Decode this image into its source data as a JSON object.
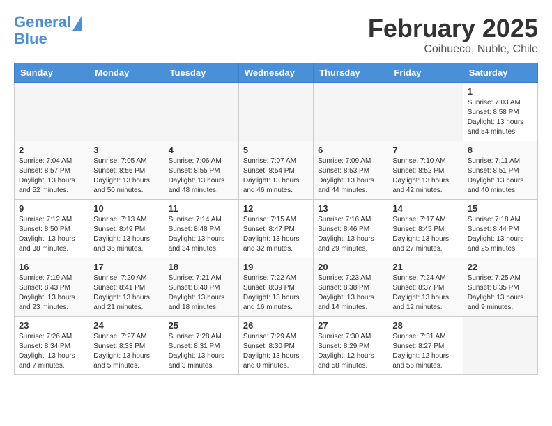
{
  "header": {
    "logo_line1": "General",
    "logo_line2": "Blue",
    "month": "February 2025",
    "location": "Coihueco, Nuble, Chile"
  },
  "days_of_week": [
    "Sunday",
    "Monday",
    "Tuesday",
    "Wednesday",
    "Thursday",
    "Friday",
    "Saturday"
  ],
  "weeks": [
    [
      {
        "num": "",
        "info": ""
      },
      {
        "num": "",
        "info": ""
      },
      {
        "num": "",
        "info": ""
      },
      {
        "num": "",
        "info": ""
      },
      {
        "num": "",
        "info": ""
      },
      {
        "num": "",
        "info": ""
      },
      {
        "num": "1",
        "info": "Sunrise: 7:03 AM\nSunset: 8:58 PM\nDaylight: 13 hours and 54 minutes."
      }
    ],
    [
      {
        "num": "2",
        "info": "Sunrise: 7:04 AM\nSunset: 8:57 PM\nDaylight: 13 hours and 52 minutes."
      },
      {
        "num": "3",
        "info": "Sunrise: 7:05 AM\nSunset: 8:56 PM\nDaylight: 13 hours and 50 minutes."
      },
      {
        "num": "4",
        "info": "Sunrise: 7:06 AM\nSunset: 8:55 PM\nDaylight: 13 hours and 48 minutes."
      },
      {
        "num": "5",
        "info": "Sunrise: 7:07 AM\nSunset: 8:54 PM\nDaylight: 13 hours and 46 minutes."
      },
      {
        "num": "6",
        "info": "Sunrise: 7:09 AM\nSunset: 8:53 PM\nDaylight: 13 hours and 44 minutes."
      },
      {
        "num": "7",
        "info": "Sunrise: 7:10 AM\nSunset: 8:52 PM\nDaylight: 13 hours and 42 minutes."
      },
      {
        "num": "8",
        "info": "Sunrise: 7:11 AM\nSunset: 8:51 PM\nDaylight: 13 hours and 40 minutes."
      }
    ],
    [
      {
        "num": "9",
        "info": "Sunrise: 7:12 AM\nSunset: 8:50 PM\nDaylight: 13 hours and 38 minutes."
      },
      {
        "num": "10",
        "info": "Sunrise: 7:13 AM\nSunset: 8:49 PM\nDaylight: 13 hours and 36 minutes."
      },
      {
        "num": "11",
        "info": "Sunrise: 7:14 AM\nSunset: 8:48 PM\nDaylight: 13 hours and 34 minutes."
      },
      {
        "num": "12",
        "info": "Sunrise: 7:15 AM\nSunset: 8:47 PM\nDaylight: 13 hours and 32 minutes."
      },
      {
        "num": "13",
        "info": "Sunrise: 7:16 AM\nSunset: 8:46 PM\nDaylight: 13 hours and 29 minutes."
      },
      {
        "num": "14",
        "info": "Sunrise: 7:17 AM\nSunset: 8:45 PM\nDaylight: 13 hours and 27 minutes."
      },
      {
        "num": "15",
        "info": "Sunrise: 7:18 AM\nSunset: 8:44 PM\nDaylight: 13 hours and 25 minutes."
      }
    ],
    [
      {
        "num": "16",
        "info": "Sunrise: 7:19 AM\nSunset: 8:43 PM\nDaylight: 13 hours and 23 minutes."
      },
      {
        "num": "17",
        "info": "Sunrise: 7:20 AM\nSunset: 8:41 PM\nDaylight: 13 hours and 21 minutes."
      },
      {
        "num": "18",
        "info": "Sunrise: 7:21 AM\nSunset: 8:40 PM\nDaylight: 13 hours and 18 minutes."
      },
      {
        "num": "19",
        "info": "Sunrise: 7:22 AM\nSunset: 8:39 PM\nDaylight: 13 hours and 16 minutes."
      },
      {
        "num": "20",
        "info": "Sunrise: 7:23 AM\nSunset: 8:38 PM\nDaylight: 13 hours and 14 minutes."
      },
      {
        "num": "21",
        "info": "Sunrise: 7:24 AM\nSunset: 8:37 PM\nDaylight: 13 hours and 12 minutes."
      },
      {
        "num": "22",
        "info": "Sunrise: 7:25 AM\nSunset: 8:35 PM\nDaylight: 13 hours and 9 minutes."
      }
    ],
    [
      {
        "num": "23",
        "info": "Sunrise: 7:26 AM\nSunset: 8:34 PM\nDaylight: 13 hours and 7 minutes."
      },
      {
        "num": "24",
        "info": "Sunrise: 7:27 AM\nSunset: 8:33 PM\nDaylight: 13 hours and 5 minutes."
      },
      {
        "num": "25",
        "info": "Sunrise: 7:28 AM\nSunset: 8:31 PM\nDaylight: 13 hours and 3 minutes."
      },
      {
        "num": "26",
        "info": "Sunrise: 7:29 AM\nSunset: 8:30 PM\nDaylight: 13 hours and 0 minutes."
      },
      {
        "num": "27",
        "info": "Sunrise: 7:30 AM\nSunset: 8:29 PM\nDaylight: 12 hours and 58 minutes."
      },
      {
        "num": "28",
        "info": "Sunrise: 7:31 AM\nSunset: 8:27 PM\nDaylight: 12 hours and 56 minutes."
      },
      {
        "num": "",
        "info": ""
      }
    ]
  ]
}
